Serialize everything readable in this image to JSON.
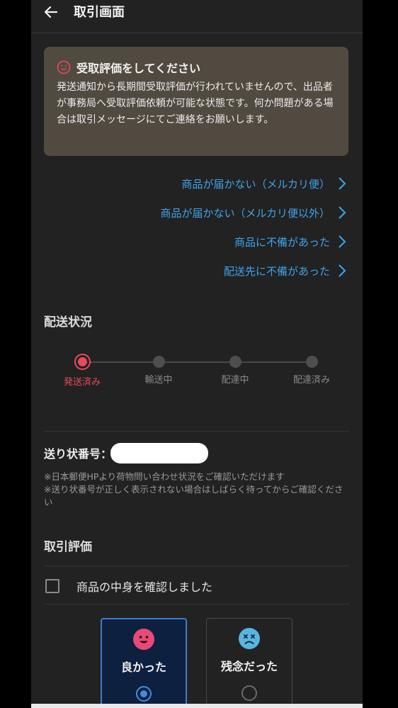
{
  "header": {
    "title": "取引画面",
    "back_icon": "arrow-left-icon"
  },
  "notice": {
    "icon": "smile-face-icon",
    "title": "受取評価をしてください",
    "body": "発送通知から長期間受取評価が行われていませんので、出品者が事務局へ受取評価依頼が可能な状態です。何か問題がある場合は取引メッセージにてご連絡をお願いします。"
  },
  "links": [
    "商品が届かない（メルカリ便）",
    "商品が届かない（メルカリ便以外）",
    "商品に不備があった",
    "配送先に不備があった"
  ],
  "shipping": {
    "title": "配送状況",
    "steps": [
      "発送済み",
      "輸送中",
      "配達中",
      "配達済み"
    ],
    "active_step": 0
  },
  "tracking": {
    "label": "送り状番号：",
    "note": "※日本郵便HPより荷物問い合わせ状況をご確認いただけます\n※送り状番号が正しく表示されない場合はしばらく待ってからご確認ください"
  },
  "rating": {
    "title": "取引評価",
    "confirm_label": "商品の中身を確認しました",
    "good_label": "良かった",
    "bad_label": "残念だった",
    "selected": "good"
  },
  "colors": {
    "accent_link": "#3fa4ea",
    "active_step": "#e84a5c",
    "selected_radio": "#3d8fe0",
    "good_face": "#e84a78",
    "bad_face": "#5ab4e0"
  }
}
